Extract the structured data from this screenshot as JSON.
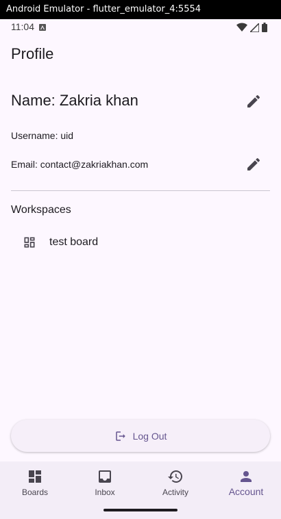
{
  "window": {
    "title": "Android Emulator - flutter_emulator_4:5554"
  },
  "status_bar": {
    "time": "11:04"
  },
  "app_bar": {
    "title": "Profile"
  },
  "profile": {
    "name_text": "Name: Zakria khan",
    "username_text": "Username: uid",
    "email_text": "Email: contact@zakriakhan.com"
  },
  "workspaces": {
    "title": "Workspaces",
    "items": [
      {
        "label": "test board",
        "icon": "dashboard-icon"
      }
    ]
  },
  "logout": {
    "label": "Log Out",
    "icon": "logout-icon"
  },
  "nav": {
    "items": [
      {
        "label": "Boards",
        "icon": "dashboard-icon",
        "active": false
      },
      {
        "label": "Inbox",
        "icon": "inbox-icon",
        "active": false
      },
      {
        "label": "Activity",
        "icon": "history-icon",
        "active": false
      },
      {
        "label": "Account",
        "icon": "person-icon",
        "active": true
      }
    ]
  },
  "colors": {
    "background": "#fdf7ff",
    "primary": "#65558f",
    "text": "#1d1b20",
    "nav_background": "#f3edf7"
  }
}
